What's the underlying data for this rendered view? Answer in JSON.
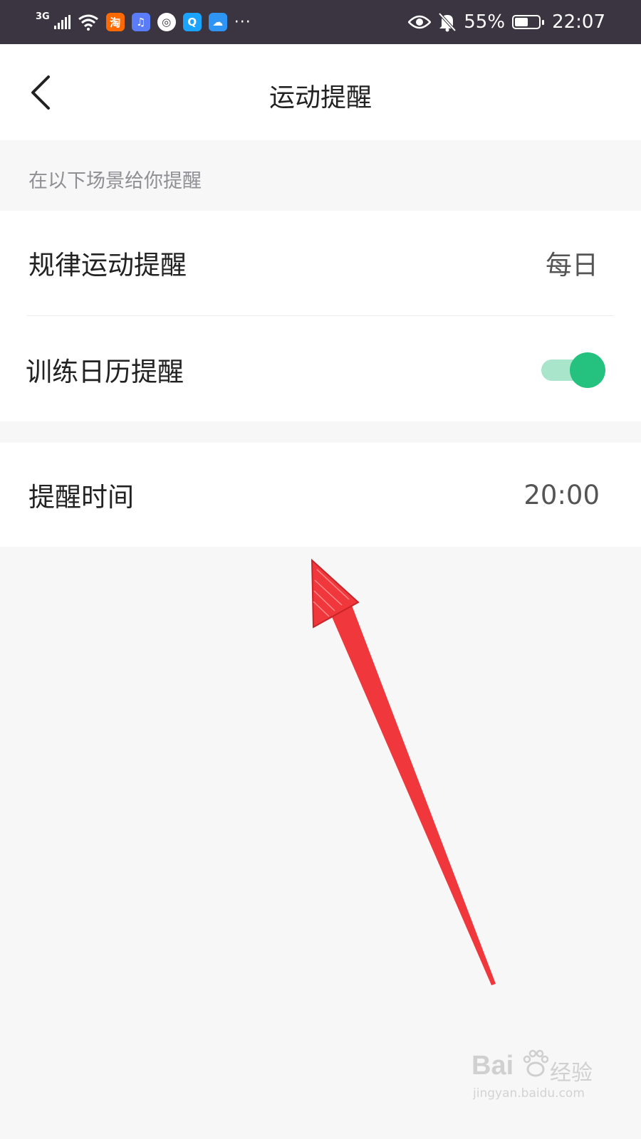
{
  "status_bar": {
    "network": "3G",
    "apps": [
      {
        "name": "taobao-app-icon",
        "glyph": "淘",
        "color": "#ff6a00"
      },
      {
        "name": "music-app-icon",
        "glyph": "♫",
        "color": "#5b7cf7"
      },
      {
        "name": "browser-app-icon",
        "glyph": "◎",
        "color": "#ffffff"
      },
      {
        "name": "search-app-icon",
        "glyph": "Q",
        "color": "#1aa3ff"
      },
      {
        "name": "weather-app-icon",
        "glyph": "☁",
        "color": "#2e95f5"
      }
    ],
    "more": "···",
    "battery_percent": "55%",
    "battery_level": 0.55,
    "time": "22:07"
  },
  "nav": {
    "title": "运动提醒"
  },
  "section": {
    "caption": "在以下场景给你提醒"
  },
  "rows": {
    "regular": {
      "label": "规律运动提醒",
      "value": "每日"
    },
    "calendar": {
      "label": "训练日历提醒",
      "toggle_on": true
    },
    "time": {
      "label": "提醒时间",
      "value": "20:00"
    }
  },
  "colors": {
    "toggle_knob": "#24c17f",
    "toggle_track": "#a8e5cb",
    "annotation_arrow": "#f0373c"
  },
  "watermark": {
    "brand": "Bai",
    "brand_cn": "经验",
    "url": "jingyan.baidu.com"
  }
}
